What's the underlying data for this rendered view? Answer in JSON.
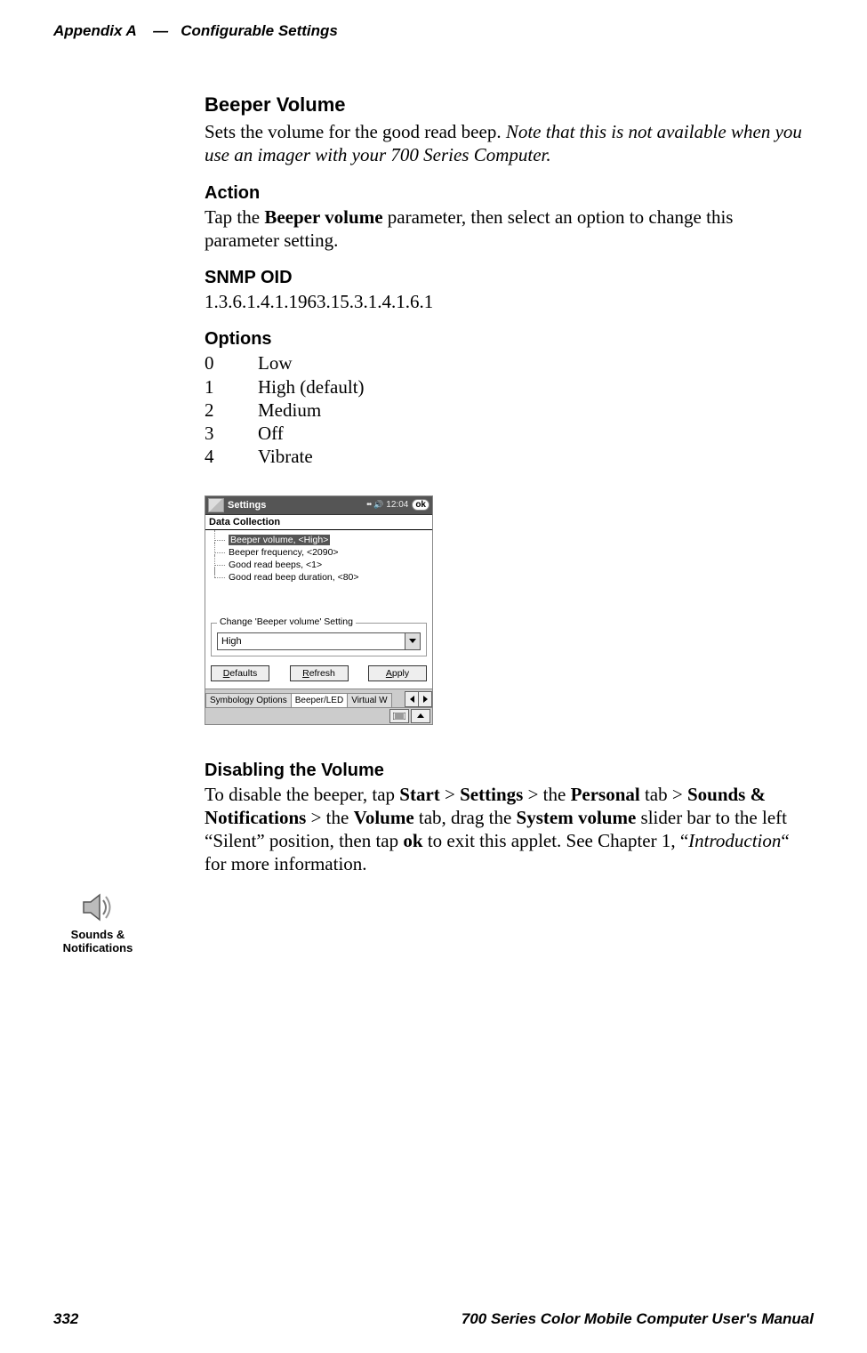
{
  "header": {
    "appendix": "Appendix A",
    "sep": "—",
    "title": "Configurable Settings"
  },
  "sections": {
    "beeper_volume": {
      "heading": "Beeper Volume",
      "body_pre": "Sets the volume for the good read beep. ",
      "body_note": "Note that this is not available when you use an imager with your 700 Series Computer."
    },
    "action": {
      "heading": "Action",
      "pre": "Tap the ",
      "bold": "Beeper volume",
      "post": " parameter, then select an option to change this parameter setting."
    },
    "snmp": {
      "heading": "SNMP OID",
      "value": "1.3.6.1.4.1.1963.15.3.1.4.1.6.1"
    },
    "options": {
      "heading": "Options",
      "rows": [
        {
          "num": "0",
          "label": "Low"
        },
        {
          "num": "1",
          "label": "High (default)"
        },
        {
          "num": "2",
          "label": "Medium"
        },
        {
          "num": "3",
          "label": "Off"
        },
        {
          "num": "4",
          "label": "Vibrate"
        }
      ]
    },
    "disable": {
      "heading": "Disabling the Volume",
      "p1": "To disable the beeper, tap ",
      "b1": "Start",
      "gt1": " > ",
      "b2": "Settings",
      "gt2": " > the ",
      "b3": "Personal",
      "t3": " tab > ",
      "b4": "Sounds & Notifications",
      "gt3": "  > the ",
      "b5": "Volume",
      "t5": " tab, drag the ",
      "b6": "System volume",
      "t6": " slider bar to the left “Silent” position, then tap ",
      "b7": "ok",
      "t7": " to exit this applet. See Chapter 1, “",
      "i1": "Introduction",
      "t8": "“ for more information."
    }
  },
  "screenshot": {
    "titlebar": {
      "label": "Settings",
      "time": "12:04",
      "ok": "ok"
    },
    "app_title": "Data Collection",
    "tree": [
      {
        "text": "Beeper volume, <High>",
        "selected": true
      },
      {
        "text": "Beeper frequency, <2090>",
        "selected": false
      },
      {
        "text": "Good read beeps, <1>",
        "selected": false
      },
      {
        "text": "Good read beep duration, <80>",
        "selected": false
      }
    ],
    "groupbox": "Change 'Beeper volume' Setting",
    "combo_value": "High",
    "buttons": {
      "defaults": {
        "u": "D",
        "rest": "efaults"
      },
      "refresh": {
        "u": "R",
        "rest": "efresh"
      },
      "apply": {
        "u": "A",
        "rest": "pply"
      }
    },
    "tabs": [
      "Symbology Options",
      "Beeper/LED",
      "Virtual W"
    ]
  },
  "side_icon": {
    "line1": "Sounds &",
    "line2": "Notifications"
  },
  "footer": {
    "page": "332",
    "title": "700 Series Color Mobile Computer User's Manual"
  }
}
